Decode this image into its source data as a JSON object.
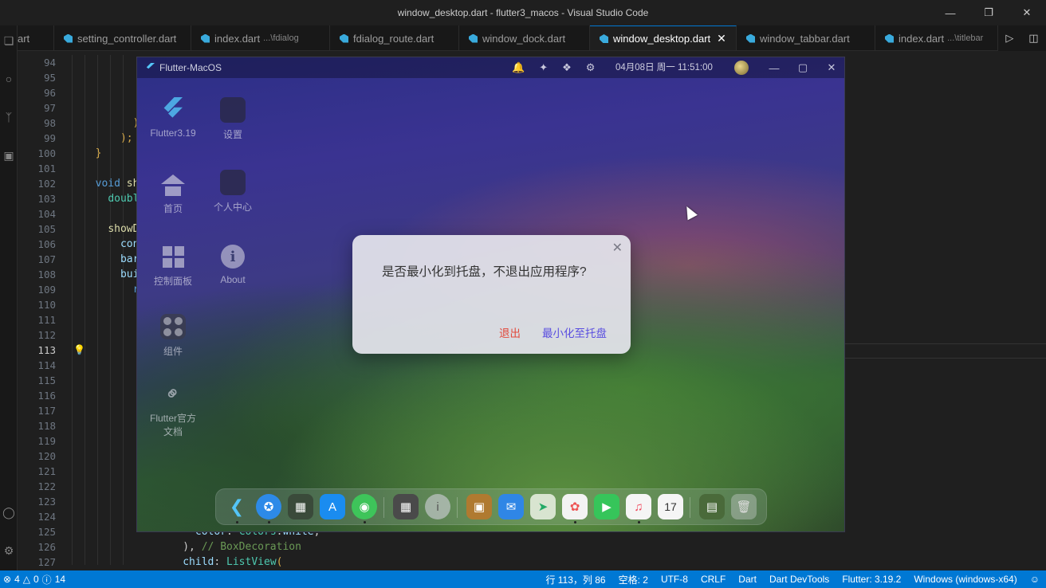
{
  "window": {
    "title": "window_desktop.dart - flutter3_macos - Visual Studio Code"
  },
  "tabs": [
    {
      "label": "art",
      "hint": ""
    },
    {
      "label": "setting_controller.dart",
      "hint": ""
    },
    {
      "label": "index.dart",
      "hint": "...\\fdialog"
    },
    {
      "label": "fdialog_route.dart",
      "hint": ""
    },
    {
      "label": "window_dock.dart",
      "hint": ""
    },
    {
      "label": "window_desktop.dart",
      "hint": ""
    },
    {
      "label": "window_tabbar.dart",
      "hint": ""
    },
    {
      "label": "index.dart",
      "hint": "...\\titlebar"
    }
  ],
  "editor": {
    "line_numbers": [
      "94",
      "95",
      "96",
      "97",
      "98",
      "99",
      "100",
      "101",
      "102",
      "103",
      "104",
      "105",
      "106",
      "107",
      "108",
      "109",
      "110",
      "111",
      "112",
      "113",
      "114",
      "115",
      "116",
      "117",
      "118",
      "119",
      "120",
      "121",
      "122",
      "123",
      "124",
      "125",
      "126",
      "127"
    ],
    "current_line": "113"
  },
  "app": {
    "title": "Flutter-MacOS",
    "datetime": "04月08日 周一 11:51:00",
    "sidebar": {
      "flutter": "Flutter3.19",
      "settings": "设置",
      "home": "首页",
      "profile": "个人中心",
      "dashboard": "控制面板",
      "about": "About",
      "widgets": "组件",
      "docs_line1": "Flutter官方",
      "docs_line2": "文档"
    },
    "dialog": {
      "message": "是否最小化到托盘，不退出应用程序?",
      "exit_label": "退出",
      "minimize_label": "最小化至托盘"
    },
    "dock_calendar_day": "17"
  },
  "status": {
    "errors": "4",
    "warnings": "0",
    "infos": "14",
    "position": "行 113，列 86",
    "spaces": "空格: 2",
    "encoding": "UTF-8",
    "eol": "CRLF",
    "language": "Dart",
    "devtools": "Dart DevTools",
    "flutter": "Flutter: 3.19.2",
    "device": "Windows (windows-x64)"
  },
  "colors": {
    "accent": "#0078d4",
    "exit": "#e24a3c",
    "minimize": "#5a4ee0"
  }
}
